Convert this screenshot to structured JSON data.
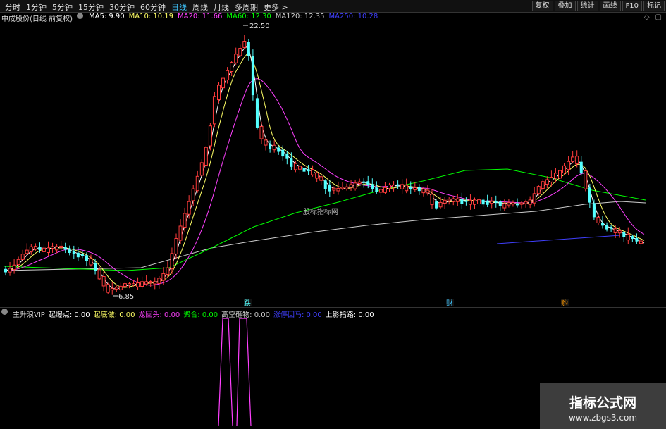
{
  "toolbar": {
    "tabs": [
      {
        "label": "分时",
        "active": false
      },
      {
        "label": "1分钟",
        "active": false
      },
      {
        "label": "5分钟",
        "active": false
      },
      {
        "label": "15分钟",
        "active": false
      },
      {
        "label": "30分钟",
        "active": false
      },
      {
        "label": "60分钟",
        "active": false
      },
      {
        "label": "日线",
        "active": true
      },
      {
        "label": "周线",
        "active": false
      },
      {
        "label": "月线",
        "active": false
      },
      {
        "label": "多周期",
        "active": false
      },
      {
        "label": "更多 >",
        "active": false
      }
    ],
    "tools": [
      "复权",
      "叠加",
      "统计",
      "画线",
      "F10",
      "标记"
    ]
  },
  "legend": {
    "stock": "中成股份(日线 前复权)",
    "ma5": "MA5: 9.90",
    "ma10": "MA10: 10.19",
    "ma20": "MA20: 11.66",
    "ma60": "MA60: 12.30",
    "ma120": "MA120: 12.35",
    "ma250": "MA250: 10.28"
  },
  "colors": {
    "up": "#ff3c3c",
    "down": "#54ffff",
    "ma5": "#ffffff",
    "ma10": "#ffff66",
    "ma20": "#ff40ff",
    "ma60": "#00ff00",
    "ma120": "#cccccc",
    "ma250": "#4040ff",
    "accent": "#3ec6ff"
  },
  "chart_data": {
    "type": "candlestick",
    "high_label": "22.50",
    "low_label": "6.85",
    "center_text": "股标指标网",
    "markers": [
      "跌",
      "财",
      "购"
    ],
    "ylim": [
      5.5,
      23.5
    ]
  },
  "indicator": {
    "name": "主升浪VIP",
    "items": [
      {
        "label": "起爆点: 0.00",
        "color": "#ffffff"
      },
      {
        "label": "起底做: 0.00",
        "color": "#ffff66"
      },
      {
        "label": "龙回头: 0.00",
        "color": "#ff40ff"
      },
      {
        "label": "聚合: 0.00",
        "color": "#00ff00"
      },
      {
        "label": "高空砸物: 0.00",
        "color": "#cccccc"
      },
      {
        "label": "涨停回马: 0.00",
        "color": "#4040ff"
      },
      {
        "label": "上影指路: 0.00",
        "color": "#ffffff"
      }
    ]
  },
  "watermark": {
    "title": "指标公式网",
    "url": "www.zbgs3.com"
  }
}
